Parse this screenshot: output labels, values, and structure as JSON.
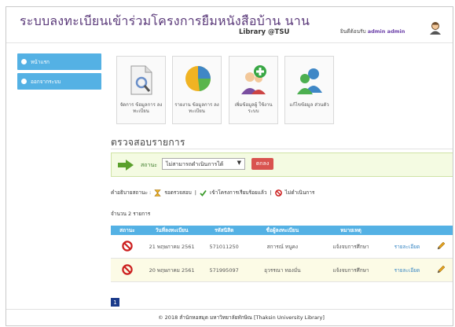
{
  "header": {
    "title": "ระบบลงทะเบียนเข้าร่วมโครงการยืมหนังสือบ้าน นาน",
    "subtitle": "Library @TSU",
    "welcome_prefix": "ยินดีต้อนรับ",
    "username": "admin admin"
  },
  "sidebar": {
    "items": [
      {
        "label": "หน้าแรก"
      },
      {
        "label": "ออกจากระบบ"
      }
    ]
  },
  "tiles": [
    {
      "label": "จัดการ ข้อมูลการ ลงทะเบียน",
      "icon": "document-search-icon"
    },
    {
      "label": "รายงาน ข้อมูลการ ลงทะเบียน",
      "icon": "pie-chart-icon"
    },
    {
      "label": "เพิ่มข้อมูลผู้ ใช้งานระบบ",
      "icon": "add-user-icon"
    },
    {
      "label": "แก้ไขข้อมูล ส่วนตัว",
      "icon": "users-icon"
    }
  ],
  "section": {
    "title": "ตรวจสอบรายการ"
  },
  "filter": {
    "label": "สถานะ",
    "selected": "ไม่สามารถดำเนินการได้",
    "button": "ตกลง"
  },
  "legend": {
    "prefix": "คำอธิบายสถานะ :",
    "pending": "รอตรวจสอบ",
    "joined": "เข้าโครงการเรียบร้อยแล้ว",
    "rejected": "ไม่ดำเนินการ"
  },
  "count": "จำนวน 2 รายการ",
  "table": {
    "headers": [
      "สถานะ",
      "วันที่ลงทะเบียน",
      "รหัสนิสิต",
      "ชื่อผู้ลงทะเบียน",
      "หมายเหตุ",
      "",
      ""
    ],
    "rows": [
      {
        "status": "rejected",
        "date": "21 พฤษภาคม 2561",
        "id": "571011250",
        "name": "สการณ์ หนูคง",
        "note": "แจ้งจบการศึกษา",
        "detail": "รายละเอียด"
      },
      {
        "status": "rejected",
        "date": "20 พฤษภาคม 2561",
        "id": "571995097",
        "name": "อุวรรณา ทองมั่น",
        "note": "แจ้งจบการศึกษา",
        "detail": "รายละเอียด"
      }
    ]
  },
  "pagination": {
    "current": "1"
  },
  "footer": "© 2018 สำนักหอสมุด มหาวิทยาลัยทักษิณ [Thaksin University Library]",
  "colors": {
    "accent_blue": "#54b1e4",
    "title_purple": "#5b3a7a",
    "button_red": "#d9534f",
    "filter_green_bg": "#f4fbe2"
  }
}
